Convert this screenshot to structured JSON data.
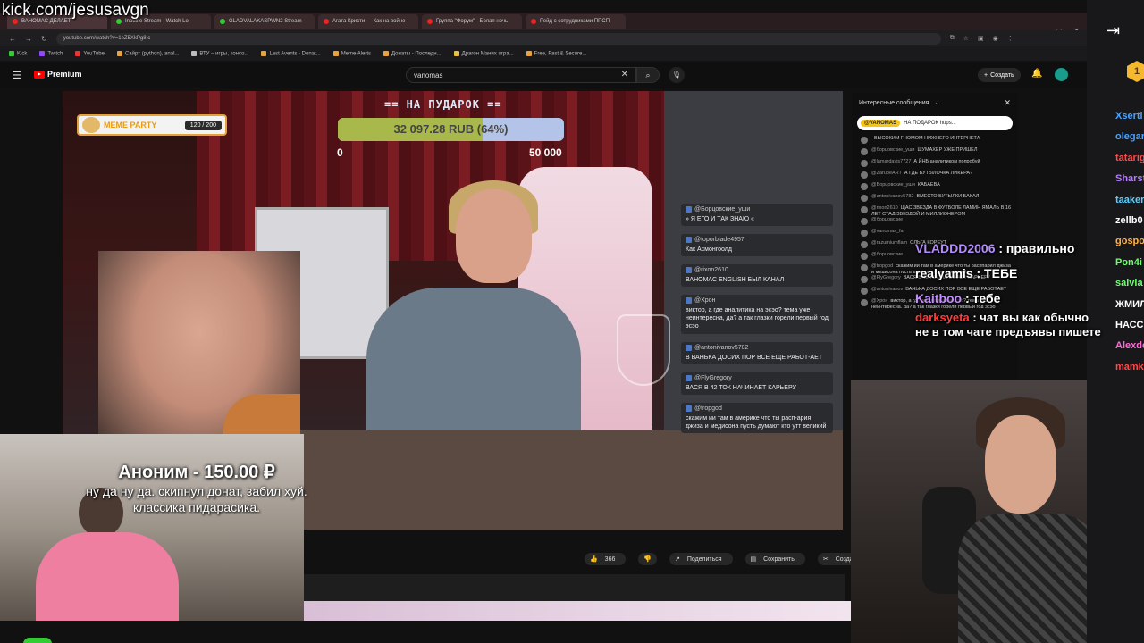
{
  "kick_url": "kick.com/jesusavgn",
  "browser": {
    "tabs": [
      "ВАНОМАС ДЕЛАЕТ",
      "Inoulife Stream - Watch Lo",
      "GLADVALAKASPWN2 Stream",
      "Агата Кристи — Как на войне",
      "Группа \"Форум\" - Белая ночь",
      "Рейд с сотрудниками ППСП"
    ],
    "address": "youtube.com/watch?v=1eZ5XkPg8Ic",
    "bookmarks": [
      "Kick",
      "Twitch",
      "YouTube",
      "Caйpт (python), anal...",
      "ВТУ – игры, консо...",
      "Last Avents - Donat...",
      "Meme Alerts",
      "Донаты - Последн...",
      "Драгон Маних игра...",
      "Free, Fast & Secure..."
    ]
  },
  "youtube": {
    "brand": "Premium",
    "search_value": "vanomas",
    "create_label": "Создать",
    "actions": [
      "366",
      "Поделиться",
      "Сохранить",
      "Создать клип"
    ]
  },
  "stream_overlay": {
    "meme_party_title": "MEME PARTY",
    "meme_party_count": "120 / 200",
    "goal_title": "== НА ПУДАРОК ==",
    "goal_amount": "32 097.28 RUB",
    "goal_percent_label": "(64%)",
    "goal_fraction": 0.64,
    "goal_min": "0",
    "goal_max": "50 000"
  },
  "video_chat": [
    {
      "user": "@Борцовские_уши",
      "text": "» Я ЕГО И ТАК ЗНАЮ «"
    },
    {
      "user": "@toporblade4957",
      "text": "Как Асмонгоолд"
    },
    {
      "user": "@rixon2610",
      "text": "ВАНОМАС ENGLISH БЫЛ КАНАЛ"
    },
    {
      "user": "@Хрон",
      "text": "виктор, а где аналитика на эсэо? тема уже неинтересна, да? а так глазки горели первый год эсэо"
    },
    {
      "user": "@antonivanov5782",
      "text": "В ВАНЬКА ДОСИХ ПОР ВСЕ ЕЩЕ РАБОТ-АЕТ"
    },
    {
      "user": "@FlyGregory",
      "text": "ВАСЯ В 42 ТОК НАЧИНАЕТ КАРЬЕРУ"
    },
    {
      "user": "@tropgod",
      "text": "скажим ии там в америке что ты расп-ария джиза и медисона пусть думают кто утт великий"
    }
  ],
  "yt_chat": {
    "header": "Интересные сообщения",
    "pinned_user": "@VANOMAS",
    "pinned_text": "НА ПОДАРОК https...",
    "messages": [
      {
        "user": "",
        "text": "ВЫСОКИМ ГНОМОМ НИЖНЕГО ИНТЕРНЕТА"
      },
      {
        "user": "@борцовские_уши",
        "text": "ШУМАХЕР УЖЕ ПРИШЕЛ"
      },
      {
        "user": "@lamardavis7727",
        "text": "А ЙНБ аналитиком попробуй"
      },
      {
        "user": "@ZarubeART",
        "text": "А ГДЕ БУТЫЛОЧКА ЛИКЕРА?"
      },
      {
        "user": "@Борцовские_уши",
        "text": "КАБАЕВА"
      },
      {
        "user": "@antonivanov5782",
        "text": "ВМЕСТО БУТЫЛКИ БАКАЛ"
      },
      {
        "user": "@rixon2610",
        "text": "ЩАС ЗВЕЗДА В ФУТБОЛЕ ЛАМИН ЯМАЛЬ В 16 ЛЕТ СТАД ЗВЕЗДОЙ И МИЛЛИОНЕРОМ"
      },
      {
        "user": "@борцовские",
        "text": ""
      },
      {
        "user": "@vanomas_fa",
        "text": ""
      },
      {
        "user": "@razumiumflam",
        "text": "ОЛЬГА КОРЕУТ"
      },
      {
        "user": "@борцовские",
        "text": ""
      },
      {
        "user": "@tropgod",
        "text": "скажим ии там в америке что ты расппарил джиза и медисона пусть думают кто утт великий"
      },
      {
        "user": "@FlyGregory",
        "text": "ВАСЯ В 42 ТОК НАЧИНАЕТ КАРЬЕРУ"
      },
      {
        "user": "@antonivanov",
        "text": "ВАНЬКА ДОСИХ ПОР ВСЕ ЕЩЕ РАБОТАЕТ"
      },
      {
        "user": "@Хрон",
        "text": "виктор, а где аналитика на эсэо? тема уже неинтересна, да? а так глазки горели первый год эсэо"
      }
    ]
  },
  "overlay_chat": [
    {
      "user": "VLADDD2006",
      "color": "#b48cff",
      "text": ": правильно"
    },
    {
      "user": "realyamis",
      "color": "#ffffff",
      "text": ": ТЕБЕ"
    },
    {
      "user": "Kaitboo",
      "color": "#c58cff",
      "text": ": тебе"
    },
    {
      "user": "darksyeta",
      "color": "#ff3b3b",
      "text": ": чат вы как обычно"
    },
    {
      "user": "",
      "color": "#ffffff",
      "text": "не в том чате предъявы пишете"
    }
  ],
  "donation": {
    "title": "Аноним - 150.00 ₽",
    "message_line1": "ну да ну да. скипнул донат, забил хуй.",
    "message_line2": "классика пидарасика."
  },
  "kick_sidebar": {
    "badge": "1",
    "users": [
      {
        "name": "Xserti",
        "color": "#4aa3ff"
      },
      {
        "name": "olegar",
        "color": "#4aa3ff"
      },
      {
        "name": "tatarig",
        "color": "#ff4a4a"
      },
      {
        "name": "Sharst",
        "color": "#b67cff"
      },
      {
        "name": "taaker",
        "color": "#5bd0ff"
      },
      {
        "name": "zellb0",
        "color": "#ffffff"
      },
      {
        "name": "gospo",
        "color": "#ffb347"
      },
      {
        "name": "Pon4i",
        "color": "#6cff6c"
      },
      {
        "name": "salvia",
        "color": "#6cff6c"
      },
      {
        "name": "ЖМИЛ",
        "color": "#ffffff"
      },
      {
        "name": "НАСС",
        "color": "#ffffff"
      },
      {
        "name": "Alexde",
        "color": "#ff6ad5"
      },
      {
        "name": "mamk",
        "color": "#ff4a4a"
      }
    ]
  }
}
